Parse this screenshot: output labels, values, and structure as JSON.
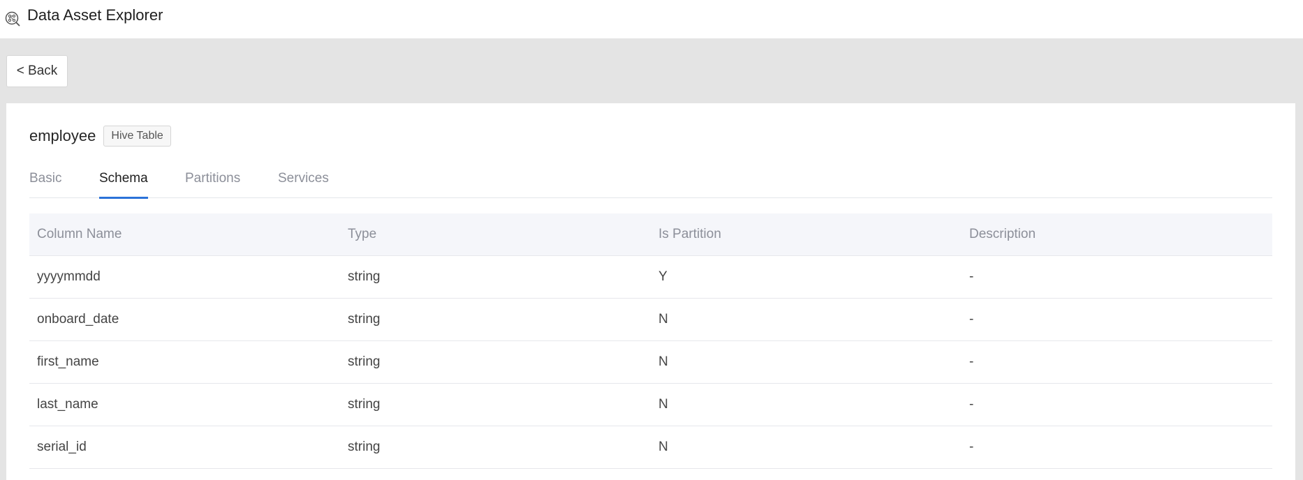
{
  "app": {
    "title": "Data Asset Explorer",
    "logo_icon": "explorer-icon"
  },
  "navigation": {
    "back_label": "< Back"
  },
  "asset": {
    "name": "employee",
    "type_badge": "Hive Table"
  },
  "tabs": [
    {
      "label": "Basic",
      "active": false
    },
    {
      "label": "Schema",
      "active": true
    },
    {
      "label": "Partitions",
      "active": false
    },
    {
      "label": "Services",
      "active": false
    }
  ],
  "schema_table": {
    "columns": [
      "Column Name",
      "Type",
      "Is Partition",
      "Description"
    ],
    "rows": [
      [
        "yyyymmdd",
        "string",
        "Y",
        "-"
      ],
      [
        "onboard_date",
        "string",
        "N",
        "-"
      ],
      [
        "first_name",
        "string",
        "N",
        "-"
      ],
      [
        "last_name",
        "string",
        "N",
        "-"
      ],
      [
        "serial_id",
        "string",
        "N",
        "-"
      ]
    ]
  },
  "colors": {
    "accent": "#2b72d8",
    "page_background": "#e4e4e4",
    "table_header_background": "#f5f6fa"
  }
}
